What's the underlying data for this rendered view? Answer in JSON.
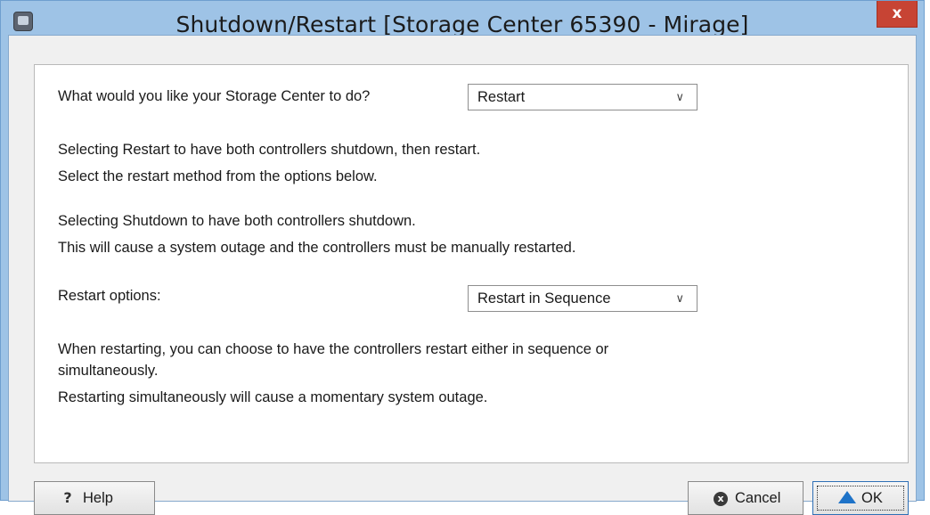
{
  "window": {
    "title": "Shutdown/Restart [Storage Center 65390 - Mirage]",
    "close_glyph": "x",
    "app_icon": "storage-manager-icon"
  },
  "form": {
    "question_label": "What would you like your Storage Center to do?",
    "action_select_value": "Restart",
    "restart_desc_line1": "Selecting Restart to have both controllers shutdown, then restart.",
    "restart_desc_line2": "Select the restart method from the options below.",
    "shutdown_desc_line1": "Selecting Shutdown to have both controllers shutdown.",
    "shutdown_desc_line2": "This will cause a system outage and the controllers must be manually restarted.",
    "restart_options_label": "Restart options:",
    "restart_options_value": "Restart in Sequence",
    "sequence_desc_line1": "When restarting, you can choose to have the controllers restart either in sequence or",
    "sequence_desc_line2": "simultaneously.",
    "sequence_desc_line3": "Restarting simultaneously will cause a momentary system outage."
  },
  "buttons": {
    "help_label": "Help",
    "help_glyph": "?",
    "cancel_label": "Cancel",
    "cancel_glyph": "x",
    "ok_label": "OK"
  },
  "icons": {
    "chevron": "chevron-down-icon",
    "help": "help-icon",
    "cancel": "cancel-icon",
    "ok": "up-arrow-icon"
  },
  "colors": {
    "title_bar": "#9ec3e6",
    "close_button": "#c74434",
    "ok_arrow": "#1e73c8"
  }
}
